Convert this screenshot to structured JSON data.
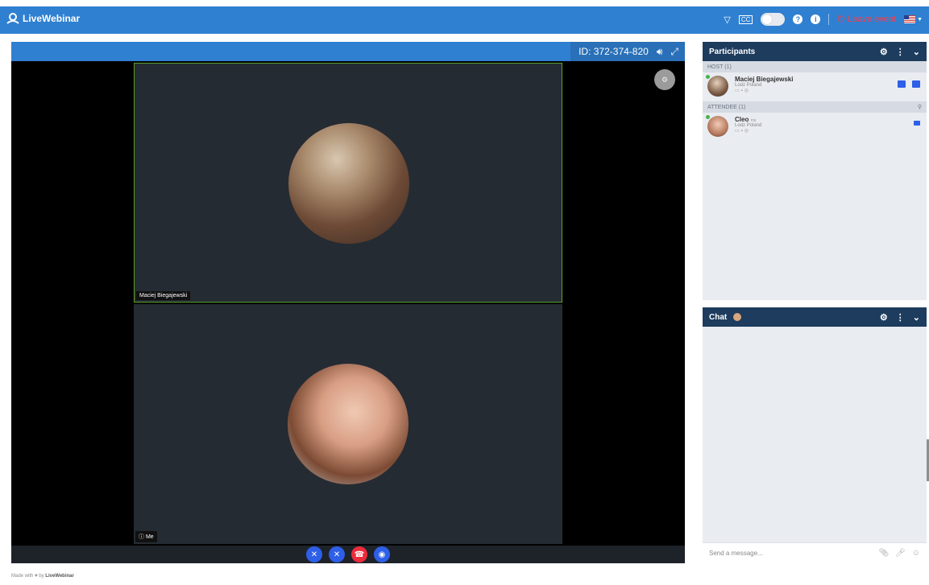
{
  "header": {
    "brand": "LiveWebinar",
    "leave_label": "Leave event"
  },
  "stage": {
    "meeting_id": "ID: 372-374-820",
    "tiles": [
      {
        "name": "Maciej Biegajewski"
      },
      {
        "name": "Me"
      }
    ]
  },
  "participants": {
    "title": "Participants",
    "host_section": "HOST (1)",
    "attendee_section": "ATTENDEE (1)",
    "host": {
      "name": "Maciej Biegajewski",
      "location": "Lodz Poland"
    },
    "attendee": {
      "name": "Cleo",
      "tag": "me",
      "location": "Lodz Poland"
    }
  },
  "chat": {
    "title": "Chat",
    "placeholder": "Send a message..."
  },
  "footer": {
    "made_with": "Made with",
    "by": "by",
    "brand": "LiveWebinar"
  },
  "colors": {
    "topbar": "#2f80d1",
    "panel_header": "#1d3c5e",
    "accent_blue": "#2d5fe8",
    "hangup_red": "#ee2b3b",
    "active_speaker_border": "#5aa12b"
  }
}
